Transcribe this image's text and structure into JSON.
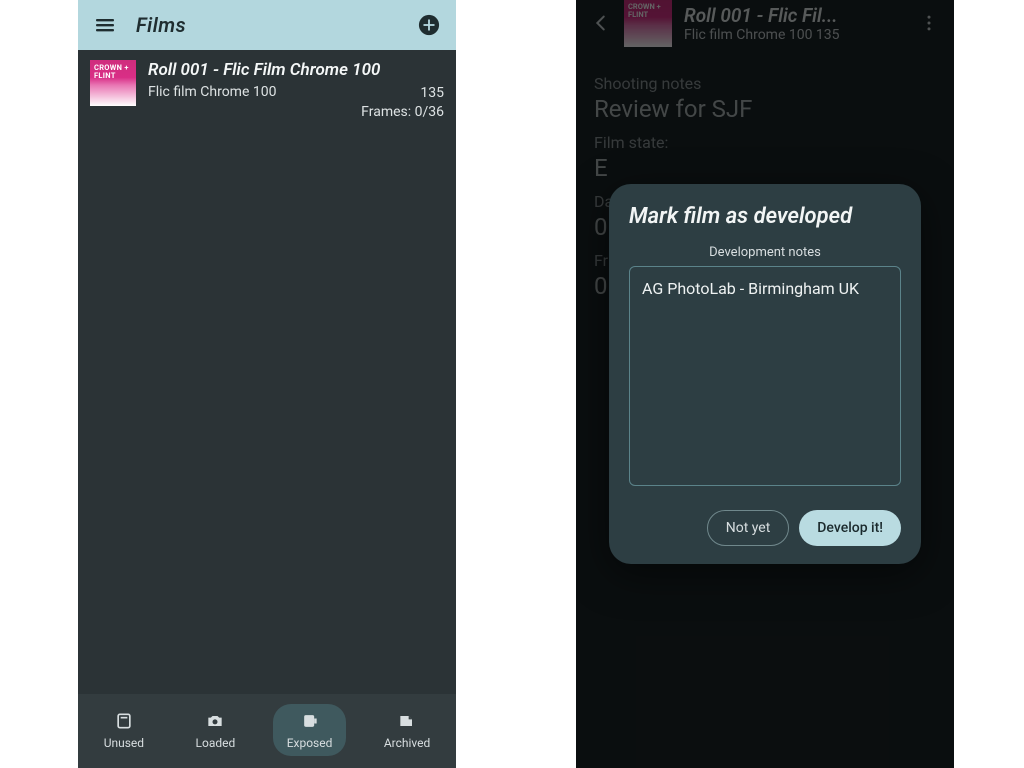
{
  "phone1": {
    "header_title": "Films",
    "film": {
      "thumb_line1": "CROWN +",
      "thumb_line2": "FLINT",
      "title": "Roll 001 - Flic Film Chrome 100",
      "stock": "Flic film Chrome 100",
      "iso": "135",
      "frames": "Frames: 0/36"
    },
    "tabs": {
      "unused": "Unused",
      "loaded": "Loaded",
      "exposed": "Exposed",
      "archived": "Archived"
    }
  },
  "phone2": {
    "thumb_line1": "CROWN +",
    "thumb_line2": "FLINT",
    "header_title": "Roll 001 - Flic Fil...",
    "header_sub": "Flic film Chrome 100 135",
    "notes_label": "Shooting notes",
    "notes_value": "Review for SJF",
    "state_label": "Film state:",
    "state_value": "E",
    "date_label": "Da",
    "date_value": "0",
    "frames_label": "Fr",
    "frames_value": "0",
    "dialog": {
      "title": "Mark film as developed",
      "sub": "Development notes",
      "notes_value": "AG PhotoLab - Birmingham UK",
      "not_yet": "Not yet",
      "develop": "Develop it!"
    }
  }
}
